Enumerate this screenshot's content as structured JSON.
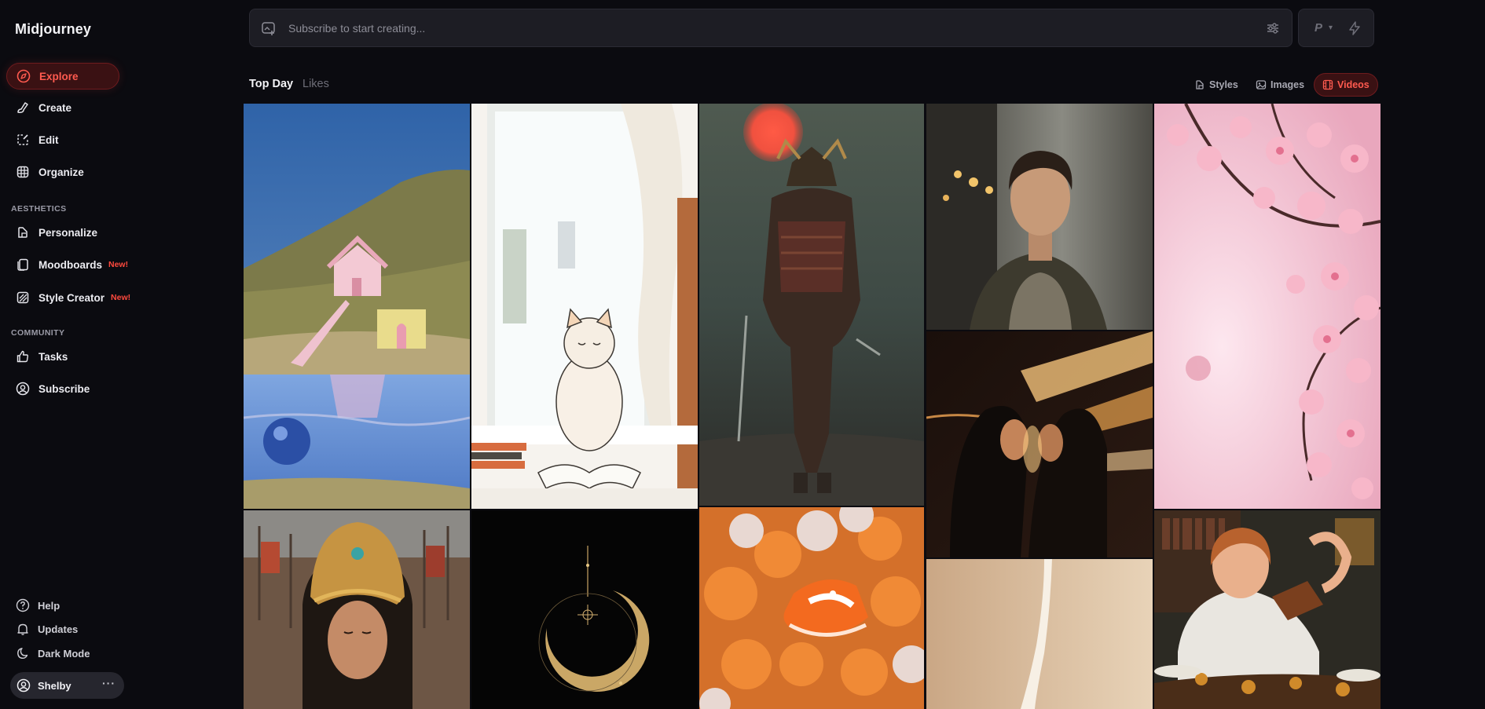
{
  "app": {
    "brand": "Midjourney"
  },
  "nav": {
    "explore": "Explore",
    "create": "Create",
    "edit": "Edit",
    "organize": "Organize",
    "aesthetics_label": "AESTHETICS",
    "personalize": "Personalize",
    "moodboards": "Moodboards",
    "moodboards_badge": "New!",
    "style_creator": "Style Creator",
    "style_creator_badge": "New!",
    "community_label": "COMMUNITY",
    "tasks": "Tasks",
    "subscribe": "Subscribe"
  },
  "bottom": {
    "help": "Help",
    "updates": "Updates",
    "dark_mode": "Dark Mode",
    "user_name": "Shelby",
    "more": "···"
  },
  "prompt": {
    "placeholder": "Subscribe to start creating...",
    "mode_letter": "P"
  },
  "tabs": {
    "top_day": "Top Day",
    "likes": "Likes"
  },
  "filters": {
    "styles": "Styles",
    "images": "Images",
    "videos": "Videos"
  },
  "colors": {
    "accent": "#ff5a4f",
    "background": "#0b0b10",
    "panel": "#1d1d24"
  },
  "gallery": [
    {
      "name": "gallery-image-pink-house-hillside"
    },
    {
      "name": "gallery-image-cat-by-window"
    },
    {
      "name": "gallery-image-samurai-red-sun"
    },
    {
      "name": "gallery-image-man-city-street"
    },
    {
      "name": "gallery-image-cherry-blossoms"
    },
    {
      "name": "gallery-image-hooded-couple-lights"
    },
    {
      "name": "gallery-image-egyptian-queen"
    },
    {
      "name": "gallery-image-golden-crescent-moon"
    },
    {
      "name": "gallery-image-orange-sneaker-balloons"
    },
    {
      "name": "gallery-image-beige-ribbon"
    },
    {
      "name": "gallery-image-man-eating-feast"
    }
  ]
}
